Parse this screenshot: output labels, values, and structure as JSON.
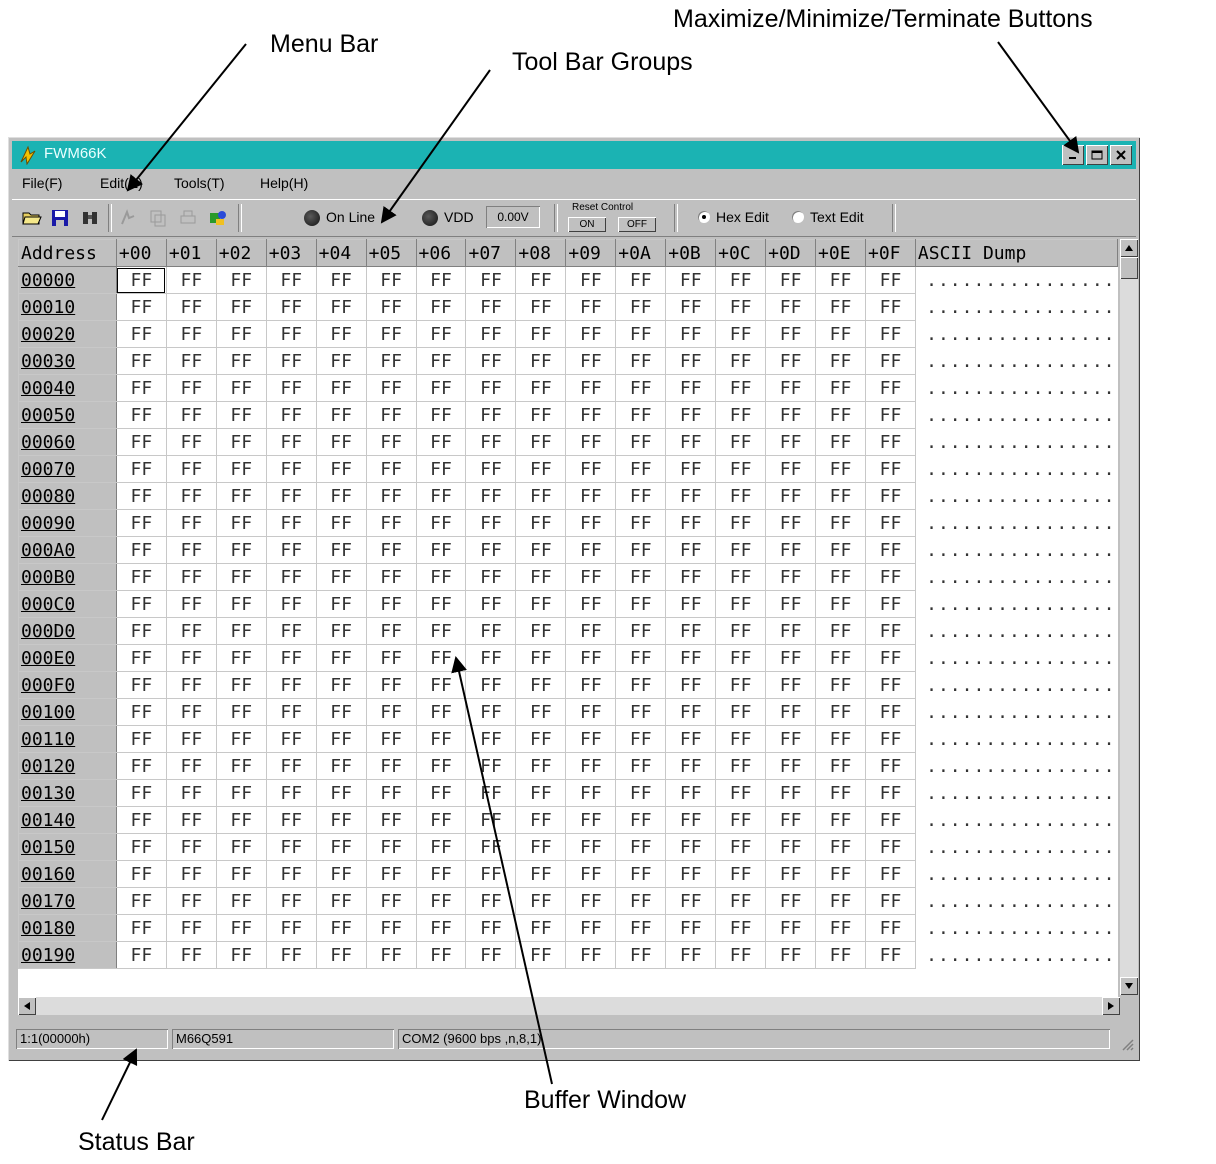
{
  "callouts": {
    "menu_bar": "Menu Bar",
    "tool_bar_groups": "Tool Bar Groups",
    "window_buttons": "Maximize/Minimize/Terminate Buttons",
    "status_bar": "Status Bar",
    "buffer_window": "Buffer Window"
  },
  "window": {
    "title": "FWM66K"
  },
  "menu": [
    "File(F)",
    "Edit(E)",
    "Tools(T)",
    "Help(H)"
  ],
  "toolbar": {
    "online_label": "On Line",
    "vdd_label": "VDD",
    "vdd_value": "0.00V",
    "reset_label": "Reset Control",
    "reset_on": "ON",
    "reset_off": "OFF",
    "hex_edit": "Hex Edit",
    "text_edit": "Text Edit",
    "selected_mode": "Hex Edit"
  },
  "grid": {
    "address_header": "Address",
    "ascii_header": "ASCII Dump",
    "columns": [
      "+00",
      "+01",
      "+02",
      "+03",
      "+04",
      "+05",
      "+06",
      "+07",
      "+08",
      "+09",
      "+0A",
      "+0B",
      "+0C",
      "+0D",
      "+0E",
      "+0F"
    ],
    "rows": [
      "00000",
      "00010",
      "00020",
      "00030",
      "00040",
      "00050",
      "00060",
      "00070",
      "00080",
      "00090",
      "000A0",
      "000B0",
      "000C0",
      "000D0",
      "000E0",
      "000F0",
      "00100",
      "00110",
      "00120",
      "00130",
      "00140",
      "00150",
      "00160",
      "00170",
      "00180",
      "00190"
    ],
    "cell_value": "FF",
    "ascii_value": "................"
  },
  "status": {
    "position": "1:1(00000h)",
    "device": "M66Q591",
    "port": "COM2 (9600 bps ,n,8,1)"
  }
}
